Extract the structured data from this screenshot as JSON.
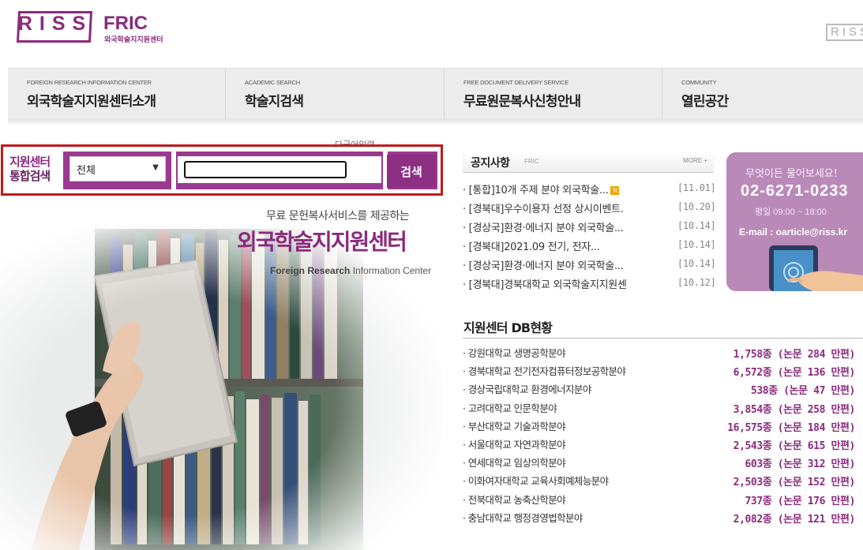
{
  "header": {
    "riss_logo": "RISS",
    "brand": "FRIC",
    "brand_sub": "외국학술지지원센터",
    "right_logo": "RISS"
  },
  "nav": [
    {
      "en": "FOREIGN RESEARCH INFORMATION CENTER",
      "ko": "외국학술지지원센터소개"
    },
    {
      "en": "ACADEMIC SEARCH",
      "ko": "학술지검색"
    },
    {
      "en": "FREE DOCUMENT DELIVERY SERVICE",
      "ko": "무료원문복사신청안내"
    },
    {
      "en": "COMMUNITY",
      "ko": "열린공간"
    }
  ],
  "search": {
    "hint": "다국어입력",
    "label_line1": "지원센터",
    "label_line2": "통합검색",
    "scope_value": "전체",
    "keyword_value": "",
    "button_label": "검색"
  },
  "hero": {
    "tagline": "무료 문헌복사서비스를 제공하는",
    "title": "외국학술지지원센터",
    "en_bold": "Foreign Research",
    "en_rest": " Information Center"
  },
  "notice": {
    "title": "공지사항",
    "sub": "FRIC",
    "more": "MORE +",
    "items": [
      {
        "title": "[통합]10개 주제 분야 외국학술...",
        "date": "[11.01]",
        "new": "N"
      },
      {
        "title": "[경북대]우수이용자 선정 상시이벤트.",
        "date": "[10.20]",
        "new": ""
      },
      {
        "title": "[경상국]환경·에너지 분야 외국학술...",
        "date": "[10.14]",
        "new": ""
      },
      {
        "title": "[경북대]2021.09 전기, 전자...",
        "date": "[10.14]",
        "new": ""
      },
      {
        "title": "[경상국]환경·에너지 분야 외국학술...",
        "date": "[10.14]",
        "new": ""
      },
      {
        "title": "[경북대]경북대학교 외국학술지지원센",
        "date": "[10.12]",
        "new": ""
      }
    ]
  },
  "help": {
    "question": "무엇이든 물어보세요!",
    "phone": "02-6271-0233",
    "hours": "평일 09:00 ~ 18:00",
    "email": "E-mail : oarticle@riss.kr"
  },
  "db": {
    "title": "지원센터 DB현황",
    "rows": [
      {
        "name": "강원대학교 생명공학분야",
        "count": "1,758종 (논문  284 만편)"
      },
      {
        "name": "경북대학교 전기전자컴퓨터정보공학분야",
        "count": "6,572종 (논문  136 만편)"
      },
      {
        "name": "경상국립대학교 환경에너지분야",
        "count": "538종 (논문  47 만편)"
      },
      {
        "name": "고려대학교 인문학분야",
        "count": "3,854종 (논문  258 만편)"
      },
      {
        "name": "부산대학교 기술과학분야",
        "count": "16,575종 (논문  184 만편)"
      },
      {
        "name": "서울대학교 자연과학분야",
        "count": "2,543종 (논문  615 만편)"
      },
      {
        "name": "연세대학교 임상의학분야",
        "count": "603종 (논문  312 만편)"
      },
      {
        "name": "이화여자대학교 교육사회예체능분야",
        "count": "2,503종 (논문  152 만편)"
      },
      {
        "name": "전북대학교 농축산학분야",
        "count": "737종 (논문  176 만편)"
      },
      {
        "name": "충남대학교 행정경영법학분야",
        "count": "2,082종 (논문  121 만편)"
      }
    ]
  },
  "colors": {
    "brand": "#8b2a7e",
    "highlight_border": "#c01a1a",
    "help_bg": "#b98ab8"
  }
}
